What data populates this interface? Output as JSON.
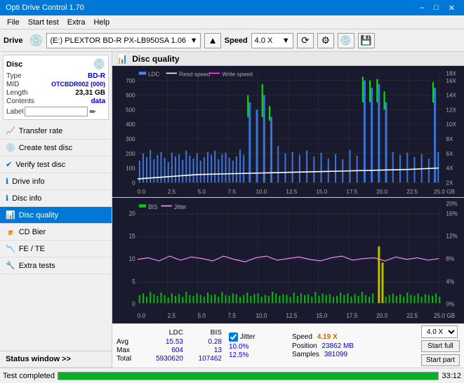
{
  "app": {
    "title": "Opti Drive Control 1.70",
    "titlebar_controls": [
      "minimize",
      "maximize",
      "close"
    ]
  },
  "menubar": {
    "items": [
      "File",
      "Start test",
      "Extra",
      "Help"
    ]
  },
  "toolbar": {
    "drive_label": "Drive",
    "drive_value": "(E:)  PLEXTOR BD-R  PX-LB950SA 1.06",
    "speed_label": "Speed",
    "speed_value": "4.0 X"
  },
  "sidebar": {
    "disc_panel": {
      "title": "Disc",
      "fields": [
        {
          "key": "Type",
          "value": "BD-R",
          "colored": true
        },
        {
          "key": "MID",
          "value": "OTCBDR002 (000)",
          "colored": true
        },
        {
          "key": "Length",
          "value": "23,31 GB",
          "colored": false
        },
        {
          "key": "Contents",
          "value": "data",
          "colored": true
        },
        {
          "key": "Label",
          "value": "",
          "colored": false
        }
      ]
    },
    "nav_items": [
      {
        "id": "transfer-rate",
        "label": "Transfer rate",
        "active": false
      },
      {
        "id": "create-test-disc",
        "label": "Create test disc",
        "active": false
      },
      {
        "id": "verify-test-disc",
        "label": "Verify test disc",
        "active": false
      },
      {
        "id": "drive-info",
        "label": "Drive info",
        "active": false
      },
      {
        "id": "disc-info",
        "label": "Disc info",
        "active": false
      },
      {
        "id": "disc-quality",
        "label": "Disc quality",
        "active": true
      },
      {
        "id": "cd-bier",
        "label": "CD Bier",
        "active": false
      },
      {
        "id": "fe-te",
        "label": "FE / TE",
        "active": false
      },
      {
        "id": "extra-tests",
        "label": "Extra tests",
        "active": false
      }
    ],
    "status_window": "Status window >>"
  },
  "chart": {
    "title": "Disc quality",
    "legend_top": [
      "LDC",
      "Read speed",
      "Write speed"
    ],
    "legend_bottom": [
      "BIS",
      "Jitter"
    ],
    "y_axis_top_left": [
      "700",
      "600",
      "500",
      "400",
      "300",
      "200",
      "100",
      "0"
    ],
    "y_axis_top_right": [
      "18X",
      "16X",
      "14X",
      "12X",
      "10X",
      "8X",
      "6X",
      "4X",
      "2X"
    ],
    "y_axis_bottom_left": [
      "20",
      "15",
      "10",
      "5"
    ],
    "y_axis_bottom_right": [
      "20%",
      "16%",
      "12%",
      "8%",
      "4%"
    ],
    "x_axis": [
      "0.0",
      "2.5",
      "5.0",
      "7.5",
      "10.0",
      "12.5",
      "15.0",
      "17.5",
      "20.0",
      "22.5",
      "25.0 GB"
    ]
  },
  "stats": {
    "columns": [
      "LDC",
      "BIS"
    ],
    "rows": [
      {
        "label": "Avg",
        "ldc": "15.53",
        "bis": "0.28"
      },
      {
        "label": "Max",
        "ldc": "604",
        "bis": "13"
      },
      {
        "label": "Total",
        "ldc": "5930620",
        "bis": "107462"
      }
    ],
    "jitter_label": "Jitter",
    "jitter_avg": "10.0%",
    "jitter_max": "12.5%",
    "speed_label": "Speed",
    "speed_value": "4.19 X",
    "speed_select": "4.0 X",
    "position_label": "Position",
    "position_value": "23862 MB",
    "samples_label": "Samples",
    "samples_value": "381099",
    "start_full": "Start full",
    "start_part": "Start part"
  },
  "statusbar": {
    "text": "Test completed",
    "progress": 100,
    "time": "33:12"
  }
}
